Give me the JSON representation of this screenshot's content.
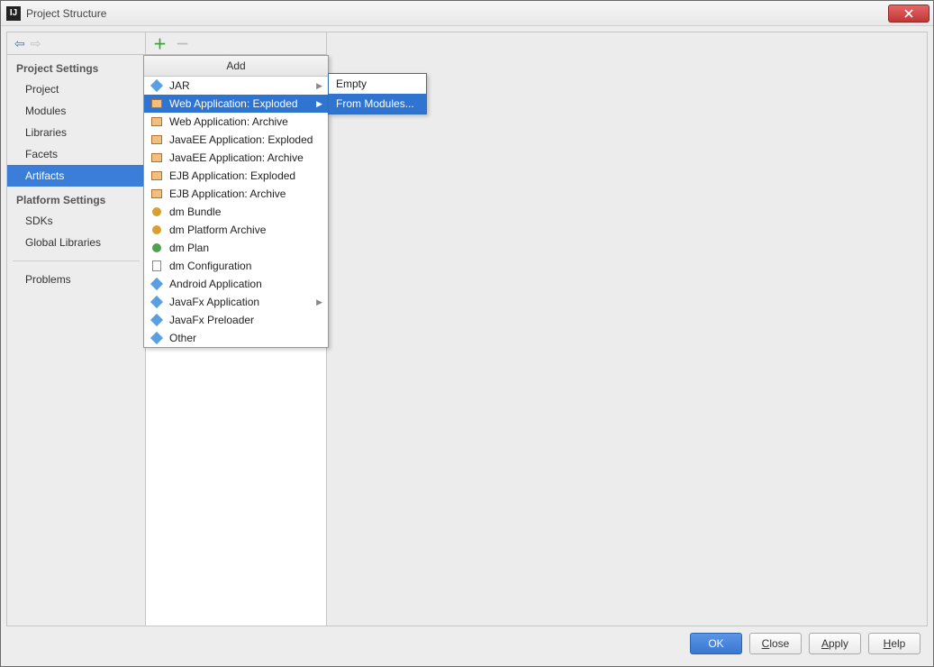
{
  "window": {
    "title": "Project Structure"
  },
  "sidebar": {
    "group1": "Project Settings",
    "items1": [
      "Project",
      "Modules",
      "Libraries",
      "Facets",
      "Artifacts"
    ],
    "selected1": 4,
    "group2": "Platform Settings",
    "items2": [
      "SDKs",
      "Global Libraries"
    ],
    "group3_item": "Problems"
  },
  "add_menu": {
    "title": "Add",
    "items": [
      {
        "label": "JAR",
        "icon": "diamond",
        "color": "#5aa0e0",
        "has_sub": true
      },
      {
        "label": "Web Application: Exploded",
        "icon": "box",
        "has_sub": true,
        "selected": true
      },
      {
        "label": "Web Application: Archive",
        "icon": "box"
      },
      {
        "label": "JavaEE Application: Exploded",
        "icon": "box"
      },
      {
        "label": "JavaEE Application: Archive",
        "icon": "box"
      },
      {
        "label": "EJB Application: Exploded",
        "icon": "box"
      },
      {
        "label": "EJB Application: Archive",
        "icon": "box"
      },
      {
        "label": "dm Bundle",
        "icon": "dot",
        "color": "#d8a030"
      },
      {
        "label": "dm Platform Archive",
        "icon": "dot",
        "color": "#d8a030"
      },
      {
        "label": "dm Plan",
        "icon": "dot",
        "color": "#50a050"
      },
      {
        "label": "dm Configuration",
        "icon": "doc"
      },
      {
        "label": "Android Application",
        "icon": "diamond",
        "color": "#5aa0e0"
      },
      {
        "label": "JavaFx Application",
        "icon": "diamond",
        "color": "#5aa0e0",
        "has_sub": true
      },
      {
        "label": "JavaFx Preloader",
        "icon": "diamond",
        "color": "#5aa0e0"
      },
      {
        "label": "Other",
        "icon": "diamond",
        "color": "#5aa0e0"
      }
    ]
  },
  "submenu": {
    "items": [
      {
        "label": "Empty"
      },
      {
        "label": "From Modules...",
        "selected": true
      }
    ]
  },
  "footer": {
    "ok": "OK",
    "close": "Close",
    "apply": "Apply",
    "help": "Help"
  }
}
